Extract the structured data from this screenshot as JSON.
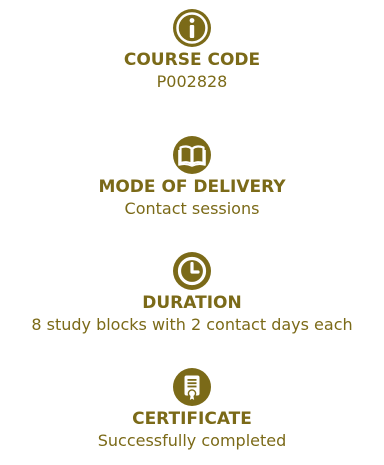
{
  "colors": {
    "accent": "#7b6a18"
  },
  "items": [
    {
      "icon": "info-icon",
      "title": "COURSE CODE",
      "value": "P002828"
    },
    {
      "icon": "book-icon",
      "title": "MODE OF DELIVERY",
      "value": "Contact sessions"
    },
    {
      "icon": "clock-icon",
      "title": "DURATION",
      "value": "8 study blocks with 2 contact days each"
    },
    {
      "icon": "certificate-icon",
      "title": "CERTIFICATE",
      "value": "Successfully completed"
    }
  ]
}
